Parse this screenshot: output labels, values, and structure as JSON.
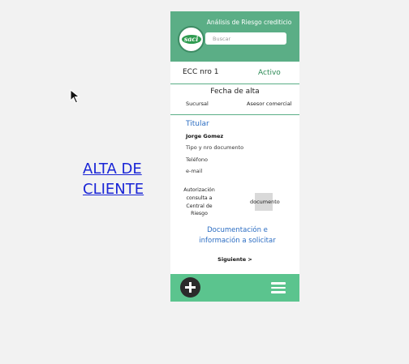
{
  "canvas_title": {
    "line1": "ALTA DE",
    "line2": "CLIENTE"
  },
  "header": {
    "app_title": "Análisis de Riesgo crediticio",
    "logo_text": "saci",
    "search_placeholder": "Buscar"
  },
  "ecc": {
    "label": "ECC nro 1",
    "status": "Activo"
  },
  "fecha": {
    "label": "Fecha de alta",
    "sucursal": "Sucursal",
    "asesor": "Asesor comercial"
  },
  "titular": {
    "section_label": "Titular",
    "nombre": "Jorge Gomez",
    "tipo_documento": "Tipo y nro documento",
    "telefono": "Teléfono",
    "email": "e-mail"
  },
  "autorizacion": {
    "lines": [
      "Autorización",
      "consulta a",
      "Central de",
      "Riesgo"
    ],
    "documento_label": "documento"
  },
  "documentacion": {
    "line1": "Documentación e",
    "line2": "información a solicitar"
  },
  "siguiente_label": "Siguiente >",
  "footer": {
    "add_icon": "plus-icon",
    "menu_icon": "hamburger-menu-icon"
  },
  "colors": {
    "header_green": "#5bae86",
    "footer_green": "#5bc48e",
    "link_blue": "#1a25d6",
    "accent_blue": "#2a6cc2"
  }
}
